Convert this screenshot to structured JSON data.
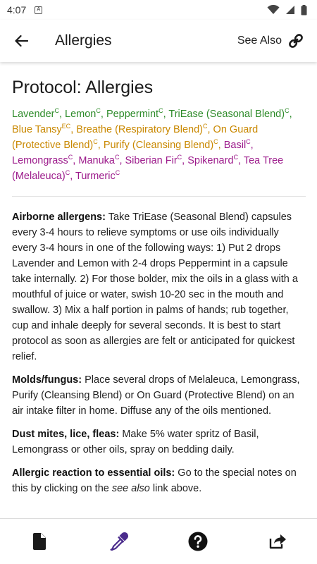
{
  "status_bar": {
    "time": "4:07"
  },
  "app_bar": {
    "title": "Allergies",
    "see_also_label": "See Also"
  },
  "protocol": {
    "title": "Protocol: Allergies",
    "oils": [
      {
        "name": "Lavender",
        "mark": "C",
        "color": "green",
        "sep": ", "
      },
      {
        "name": "Lemon",
        "mark": "C",
        "color": "green",
        "sep": ", "
      },
      {
        "name": "Peppermint",
        "mark": "C",
        "color": "green",
        "sep": ", "
      },
      {
        "name": "TriEase (Seasonal Blend)",
        "mark": "C",
        "color": "green",
        "sep": ", "
      },
      {
        "name": "Blue Tansy",
        "mark": "EC",
        "color": "orange",
        "sep": ", "
      },
      {
        "name": "Breathe (Respiratory Blend)",
        "mark": "C",
        "color": "orange",
        "sep": ", "
      },
      {
        "name": "On Guard (Protective Blend)",
        "mark": "C",
        "color": "orange",
        "sep": ", "
      },
      {
        "name": "Purify (Cleansing Blend)",
        "mark": "C",
        "color": "orange",
        "sep": ", "
      },
      {
        "name": "Basil",
        "mark": "C",
        "color": "magenta",
        "sep": ", "
      },
      {
        "name": "Lemongrass",
        "mark": "C",
        "color": "magenta",
        "sep": ", "
      },
      {
        "name": "Manuka",
        "mark": "C",
        "color": "magenta",
        "sep": ", "
      },
      {
        "name": "Siberian Fir",
        "mark": "C",
        "color": "magenta",
        "sep": ", "
      },
      {
        "name": "Spikenard",
        "mark": "C",
        "color": "magenta",
        "sep": ", "
      },
      {
        "name": "Tea Tree (Melaleuca)",
        "mark": "C",
        "color": "magenta",
        "sep": ", "
      },
      {
        "name": "Turmeric",
        "mark": "C",
        "color": "magenta",
        "sep": ""
      }
    ],
    "colors": {
      "green": "#2e8b2a",
      "orange": "#c98800",
      "magenta": "#9c1a8b"
    },
    "sections": [
      {
        "heading": "Airborne allergens:",
        "text": " Take TriEase (Seasonal Blend) capsules every 3-4 hours to relieve symptoms or use oils individually every 3-4 hours in one of the following ways: 1) Put 2 drops Lavender and Lemon with 2-4 drops Peppermint in a capsule take internally. 2) For those bolder, mix the oils in a glass with a mouthful of juice or water, swish 10-20 sec in the mouth and swallow. 3) Mix a half portion in palms of hands; rub together, cup and inhale deeply for several seconds. It is best to start protocol as soon as allergies are felt or anticipated for quickest relief."
      },
      {
        "heading": "Molds/fungus:",
        "text": " Place several drops of Melaleuca, Lemongrass, Purify (Cleansing Blend) or On Guard (Protective Blend) on an air intake filter in home. Diffuse any of the oils mentioned."
      },
      {
        "heading": "Dust mites, lice, fleas:",
        "text": " Make 5% water spritz of Basil, Lemongrass or other oils, spray on bedding daily."
      },
      {
        "heading": "Allergic reaction to essential oils:",
        "text_before": " Go to the special notes on this by clicking on the ",
        "emphasis": "see also",
        "text_after": " link above."
      }
    ]
  },
  "bottom_nav": [
    "document-icon",
    "eyedropper-icon",
    "help-icon",
    "share-icon"
  ]
}
